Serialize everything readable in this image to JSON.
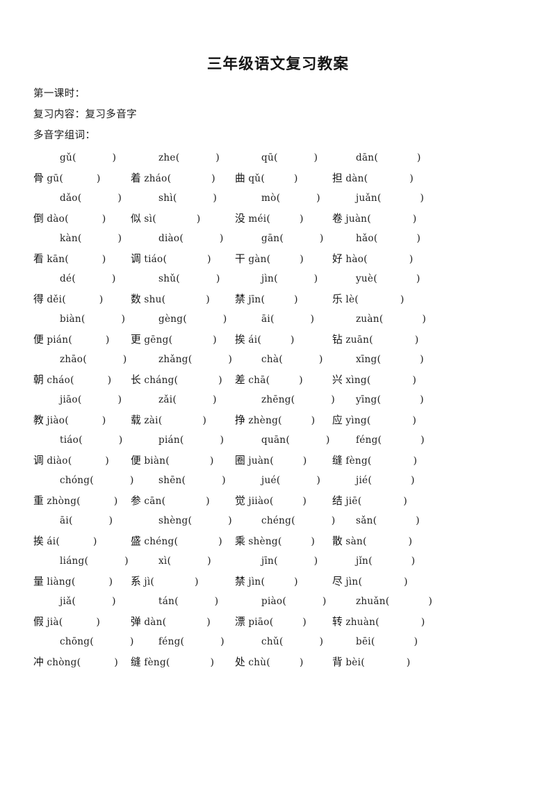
{
  "document": {
    "title": "三年级语文复习教案",
    "intro_lines": [
      "第一课时：",
      "复习内容：复习多音字",
      "多音字组词："
    ]
  },
  "blank_paren": {
    "open": "（",
    "close": "）",
    "open_ascii": "(",
    "close_ascii": ")"
  },
  "exercise": {
    "section_label": "多音字组词：",
    "layout": {
      "columns_per_group": 4,
      "rows_per_group": 2,
      "note": "每组上行仅注音，下行为汉字加另一读音，括号内留空填词"
    },
    "groups": [
      {
        "index": 1,
        "top": [
          {
            "pinyin": "gǔ"
          },
          {
            "pinyin": "zhe"
          },
          {
            "pinyin": "qū"
          },
          {
            "pinyin": "dān"
          }
        ],
        "bottom": [
          {
            "char": "骨",
            "pinyin": "gū"
          },
          {
            "char": "着",
            "pinyin": "zháo"
          },
          {
            "char": "曲",
            "pinyin": "qǔ"
          },
          {
            "char": "担",
            "pinyin": "dàn"
          }
        ]
      },
      {
        "index": 2,
        "top": [
          {
            "pinyin": "dǎo"
          },
          {
            "pinyin": "shì"
          },
          {
            "pinyin": "mò"
          },
          {
            "pinyin": "juǎn"
          }
        ],
        "bottom": [
          {
            "char": "倒",
            "pinyin": "dào"
          },
          {
            "char": "似",
            "pinyin": "sì"
          },
          {
            "char": "没",
            "pinyin": "méi"
          },
          {
            "char": "卷",
            "pinyin": "juàn"
          }
        ]
      },
      {
        "index": 3,
        "top": [
          {
            "pinyin": "kàn"
          },
          {
            "pinyin": "diào"
          },
          {
            "pinyin": "gān"
          },
          {
            "pinyin": "hǎo"
          }
        ],
        "bottom": [
          {
            "char": "看",
            "pinyin": "kān"
          },
          {
            "char": "调",
            "pinyin": "tiáo"
          },
          {
            "char": "干",
            "pinyin": "gàn"
          },
          {
            "char": "好",
            "pinyin": "hào"
          }
        ]
      },
      {
        "index": 4,
        "top": [
          {
            "pinyin": "dé"
          },
          {
            "pinyin": "shǔ"
          },
          {
            "pinyin": "jìn"
          },
          {
            "pinyin": "yuè"
          }
        ],
        "bottom": [
          {
            "char": "得",
            "pinyin": "děi"
          },
          {
            "char": "数",
            "pinyin": "shu"
          },
          {
            "char": "禁",
            "pinyin": "jīn"
          },
          {
            "char": "乐",
            "pinyin": "lè"
          }
        ]
      },
      {
        "index": 5,
        "top": [
          {
            "pinyin": "biàn"
          },
          {
            "pinyin": "gèng"
          },
          {
            "pinyin": "āi"
          },
          {
            "pinyin": "zuàn"
          }
        ],
        "bottom": [
          {
            "char": "便",
            "pinyin": "pián"
          },
          {
            "char": "更",
            "pinyin": "gēng"
          },
          {
            "char": "挨",
            "pinyin": "ái"
          },
          {
            "char": "钻",
            "pinyin": "zuān"
          }
        ]
      },
      {
        "index": 6,
        "top": [
          {
            "pinyin": "zhāo"
          },
          {
            "pinyin": "zhǎng"
          },
          {
            "pinyin": "chà"
          },
          {
            "pinyin": "xīng"
          }
        ],
        "bottom": [
          {
            "char": "朝",
            "pinyin": "cháo"
          },
          {
            "char": "长",
            "pinyin": "cháng"
          },
          {
            "char": "差",
            "pinyin": "chā"
          },
          {
            "char": "兴",
            "pinyin": "xìng"
          }
        ]
      },
      {
        "index": 7,
        "top": [
          {
            "pinyin": "jiāo"
          },
          {
            "pinyin": "zǎi"
          },
          {
            "pinyin": "zhēng"
          },
          {
            "pinyin": "yīng"
          }
        ],
        "bottom": [
          {
            "char": "教",
            "pinyin": "jiào"
          },
          {
            "char": "载",
            "pinyin": "zài"
          },
          {
            "char": "挣",
            "pinyin": "zhèng"
          },
          {
            "char": "应",
            "pinyin": "yìng"
          }
        ]
      },
      {
        "index": 8,
        "top": [
          {
            "pinyin": "tiáo"
          },
          {
            "pinyin": "pián"
          },
          {
            "pinyin": "quān"
          },
          {
            "pinyin": "féng"
          }
        ],
        "bottom": [
          {
            "char": "调",
            "pinyin": "diào"
          },
          {
            "char": "便",
            "pinyin": "biàn"
          },
          {
            "char": "圈",
            "pinyin": "juàn"
          },
          {
            "char": "缝",
            "pinyin": "fèng"
          }
        ]
      },
      {
        "index": 9,
        "top": [
          {
            "pinyin": "chóng"
          },
          {
            "pinyin": "shēn"
          },
          {
            "pinyin": "jué"
          },
          {
            "pinyin": "jié"
          }
        ],
        "bottom": [
          {
            "char": "重",
            "pinyin": "zhòng"
          },
          {
            "char": "参",
            "pinyin": "cān"
          },
          {
            "char": "觉",
            "pinyin": "jiiào"
          },
          {
            "char": "结",
            "pinyin": "jiē"
          }
        ]
      },
      {
        "index": 10,
        "top": [
          {
            "pinyin": "āi"
          },
          {
            "pinyin": "shèng"
          },
          {
            "pinyin": "chéng"
          },
          {
            "pinyin": "sǎn"
          }
        ],
        "bottom": [
          {
            "char": "挨",
            "pinyin": "ái"
          },
          {
            "char": "盛",
            "pinyin": "chéng"
          },
          {
            "char": "乘",
            "pinyin": "shèng"
          },
          {
            "char": "散",
            "pinyin": "sàn"
          }
        ]
      },
      {
        "index": 11,
        "top": [
          {
            "pinyin": "liáng"
          },
          {
            "pinyin": "xì"
          },
          {
            "pinyin": "jīn"
          },
          {
            "pinyin": "jǐn"
          }
        ],
        "bottom": [
          {
            "char": "量",
            "pinyin": "liàng"
          },
          {
            "char": "系",
            "pinyin": "jì"
          },
          {
            "char": "禁",
            "pinyin": "jìn"
          },
          {
            "char": "尽",
            "pinyin": "jìn"
          }
        ]
      },
      {
        "index": 12,
        "top": [
          {
            "pinyin": "jiǎ"
          },
          {
            "pinyin": "tán"
          },
          {
            "pinyin": "piào"
          },
          {
            "pinyin": "zhuǎn"
          }
        ],
        "bottom": [
          {
            "char": "假",
            "pinyin": "jià"
          },
          {
            "char": "弹",
            "pinyin": "dàn"
          },
          {
            "char": "漂",
            "pinyin": "piāo"
          },
          {
            "char": "转",
            "pinyin": "zhuàn"
          }
        ]
      },
      {
        "index": 13,
        "top": [
          {
            "pinyin": "chōng"
          },
          {
            "pinyin": "féng"
          },
          {
            "pinyin": "chǔ"
          },
          {
            "pinyin": "bēi"
          }
        ],
        "bottom": [
          {
            "char": "冲",
            "pinyin": "chòng"
          },
          {
            "char": "缝",
            "pinyin": "fèng"
          },
          {
            "char": "处",
            "pinyin": "chù"
          },
          {
            "char": "背",
            "pinyin": "bèi"
          }
        ]
      }
    ]
  }
}
